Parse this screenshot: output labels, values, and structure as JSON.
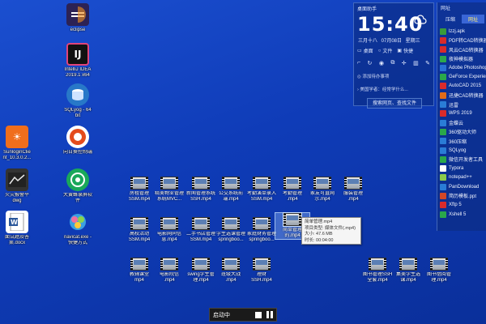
{
  "desktop_icons": [
    {
      "name": "eclipse",
      "line1": "eclipse",
      "line2": "",
      "color": "#2c2255",
      "glyph": "e"
    },
    {
      "name": "intellij",
      "line1": "IntelliJ IDEA",
      "line2": "2019.1 x64",
      "color": "#1c1c5c",
      "glyph": "IJ"
    },
    {
      "name": "sqlyog",
      "line1": "SQLyog - 64",
      "line2": "bit",
      "color": "#2878c8",
      "glyph": "S"
    },
    {
      "name": "sunlogin",
      "line1": "SunloginClie",
      "line2": "nt_10.3.0.2...",
      "color": "#f06e1c",
      "glyph": "☀"
    },
    {
      "name": "remote-control",
      "line1": "向日葵控制端",
      "line2": "",
      "color": "#e44b1c",
      "glyph": "☀"
    },
    {
      "name": "dwg",
      "line1": "火灾报警平",
      "line2": "dwg",
      "color": "#3a3a3a",
      "glyph": "▦"
    },
    {
      "name": "dajiang",
      "line1": "大黄蜂录屏软",
      "line2": "件",
      "color": "#1aa85a",
      "glyph": "◉"
    },
    {
      "name": "docx",
      "line1": "面试题及答",
      "line2": "案.docx",
      "color": "#2b579a",
      "glyph": "W"
    },
    {
      "name": "navicat",
      "line1": "navicat.exe -",
      "line2": "快捷方式",
      "color": "#5ab2e8",
      "glyph": "N"
    }
  ],
  "videos": [
    {
      "l1": "房租管理",
      "l2": "SSM.mp4"
    },
    {
      "l1": "精美物业管理",
      "l2": "系统MVC..."
    },
    {
      "l1": "新闻管理系统",
      "l2": "SSH.mp4"
    },
    {
      "l1": "公交系统前",
      "l2": "端.mp4"
    },
    {
      "l1": "考勤演单录入",
      "l2": "SSM.mp4"
    },
    {
      "l1": "考勤管理",
      "l2": ".mp4"
    },
    {
      "l1": "家友可直网",
      "l2": "示.mp4"
    },
    {
      "l1": "服装管理",
      "l2": ".mp4"
    },
    {
      "l1": "高校活动",
      "l2": "SSM.mp4"
    },
    {
      "l1": "电影网同信",
      "l2": "息.mp4"
    },
    {
      "l1": "二手书店管理",
      "l2": "SSM.mp4"
    },
    {
      "l1": "学生选课管理",
      "l2": "springboo..."
    },
    {
      "l1": "家庭财务管理",
      "l2": "springboo..."
    },
    {
      "l1": "简单管理",
      "l2": "的.mp4"
    },
    {
      "l1": "教辅课堂",
      "l2": "mp4"
    },
    {
      "l1": "电影院信",
      "l2": ".mp4"
    },
    {
      "l1": "swing学生管",
      "l2": "理.mp4"
    },
    {
      "l1": "班级大战",
      "l2": ".mp4"
    },
    {
      "l1": "理财",
      "l2": "SSH.mp4"
    },
    {
      "l1": "图书管理SSH",
      "l2": "全套.mp4"
    },
    {
      "l1": "集美学生选",
      "l2": "课.mp4"
    },
    {
      "l1": "图书借阅管",
      "l2": "理.mp4"
    }
  ],
  "tooltip": {
    "name": "简单管理.mp4",
    "type": "项目类型: 媒体文件(.mp4)",
    "size": "大小: 47.6 MB",
    "duration": "时长: 00:04:00"
  },
  "clock_panel": {
    "title": "桌面助手",
    "time": "15:40",
    "date": "三月十八  07月08日  星期三",
    "weather": "cloudy",
    "tabs": [
      "桌面",
      "文件",
      "快捷"
    ],
    "rows": [
      "◎ 添加待办事项",
      "› 美国学者：经常学什么..."
    ],
    "search": "搜索网页、查找文件"
  },
  "sidebar": {
    "title": "网址",
    "tabs": [
      "压缩",
      "网址"
    ],
    "active_tab": 1,
    "items": [
      {
        "label": "lzzj.apk",
        "color": "#3a9a3a"
      },
      {
        "label": "PDF转CAD转换器",
        "color": "#d92b2b"
      },
      {
        "label": "风云CAD转换器",
        "color": "#d92b2b"
      },
      {
        "label": "夜神模拟器",
        "color": "#2ca84c"
      },
      {
        "label": "Adobe Photoshop",
        "color": "#2a6fd6"
      },
      {
        "label": "GeForce Experience",
        "color": "#2aa84a"
      },
      {
        "label": "AutoCAD 2015",
        "color": "#d92b2b"
      },
      {
        "label": "迅捷CAD转换器",
        "color": "#e06b18"
      },
      {
        "label": "迅雷",
        "color": "#2a7cd6"
      },
      {
        "label": "WPS 2019",
        "color": "#d92b2b"
      },
      {
        "label": "金蝶云",
        "color": "#2a7cd6"
      },
      {
        "label": "360驱动大师",
        "color": "#2aa84a"
      },
      {
        "label": "360压缩",
        "color": "#2a7cd6"
      },
      {
        "label": "SQLyog",
        "color": "#2a7cd6"
      },
      {
        "label": "微信开发者工具",
        "color": "#2aa84a"
      },
      {
        "label": "Typora",
        "color": "#ffffff"
      },
      {
        "label": "notepad++",
        "color": "#8bcb4b"
      },
      {
        "label": "PanDownload",
        "color": "#2a7cd6"
      },
      {
        "label": "简历模板.ppt",
        "color": "#d24726"
      },
      {
        "label": "Xftp 5",
        "color": "#d92b2b"
      },
      {
        "label": "Xshell 5",
        "color": "#2aa84a"
      }
    ]
  },
  "recorder": {
    "status": "启动中"
  }
}
